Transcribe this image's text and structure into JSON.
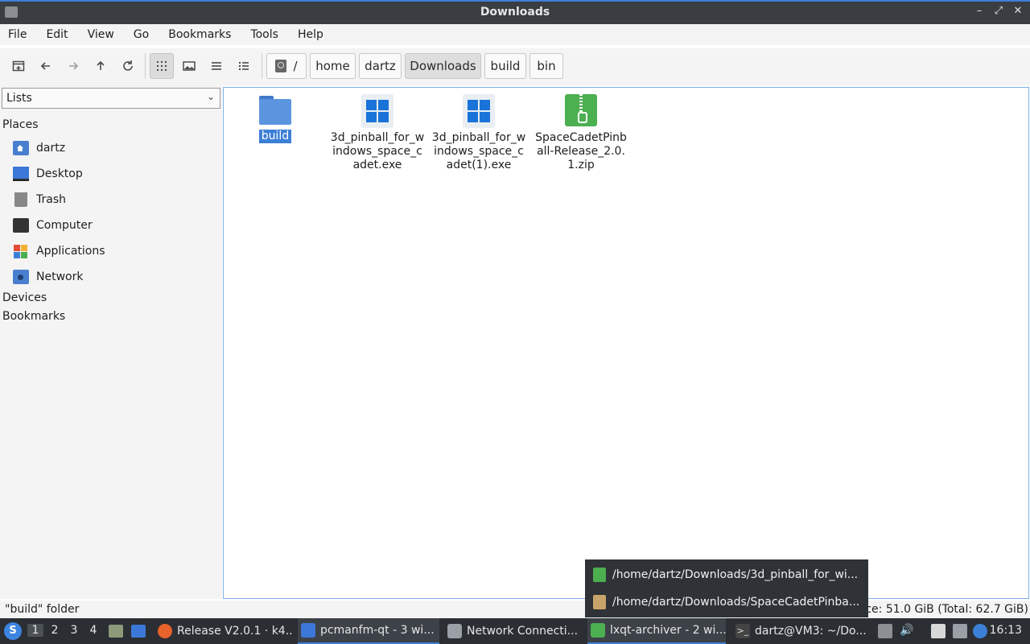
{
  "window": {
    "title": "Downloads",
    "buttons": {
      "minimize": "–",
      "maximize": "⤢",
      "close": "✕"
    }
  },
  "menubar": [
    "File",
    "Edit",
    "View",
    "Go",
    "Bookmarks",
    "Tools",
    "Help"
  ],
  "toolbar": {
    "icons": [
      "new-tab-icon",
      "back-arrow-icon",
      "forward-arrow-icon",
      "up-arrow-icon",
      "reload-icon",
      "icon-view-icon",
      "thumbnail-view-icon",
      "compact-view-icon",
      "detailed-list-icon"
    ],
    "active_view": "icon-view"
  },
  "breadcrumbs": [
    "/",
    "home",
    "dartz",
    "Downloads",
    "build",
    "bin"
  ],
  "sidebar": {
    "selector": "Lists",
    "places_header": "Places",
    "places": [
      "dartz",
      "Desktop",
      "Trash",
      "Computer",
      "Applications",
      "Network"
    ],
    "devices_header": "Devices",
    "bookmarks_header": "Bookmarks"
  },
  "files": [
    {
      "name": "build",
      "type": "folder",
      "selected": true
    },
    {
      "name": "3d_pinball_for_windows_space_cadet.exe",
      "type": "exe"
    },
    {
      "name": "3d_pinball_for_windows_space_cadet(1).exe",
      "type": "exe"
    },
    {
      "name": "SpaceCadetPinball-Release_2.0.1.zip",
      "type": "zip"
    }
  ],
  "status": {
    "left": "\"build\" folder",
    "right": "Free space: 51.0 GiB (Total: 62.7 GiB)"
  },
  "popup": {
    "rows": [
      "/home/dartz/Downloads/3d_pinball_for_wi...",
      "/home/dartz/Downloads/SpaceCadetPinba..."
    ]
  },
  "taskbar": {
    "desktops": [
      "1",
      "2",
      "3",
      "4"
    ],
    "tasks": [
      "Release V2.0.1 · k4...",
      "pcmanfm-qt - 3 wi...",
      "Network Connecti...",
      "lxqt-archiver - 2 wi...",
      "dartz@VM3: ~/Do..."
    ],
    "clock": "16:13"
  },
  "colors": {
    "accent": "#3c7fd6",
    "taskbar": "#2b2e33",
    "zip": "#4caf50",
    "folder": "#5b95e0"
  }
}
